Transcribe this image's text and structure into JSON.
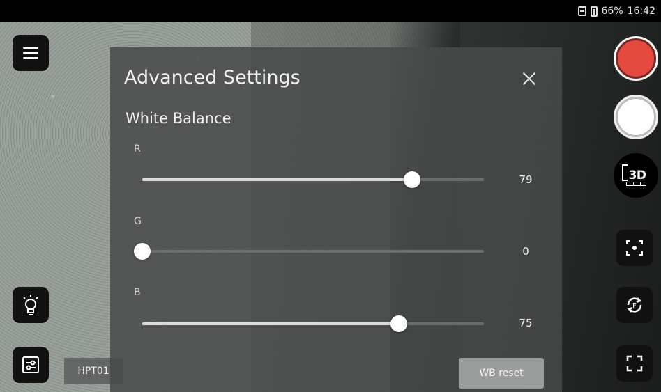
{
  "status_bar": {
    "battery": "66%",
    "time": "16:42",
    "icons": [
      "sim-card-icon",
      "battery-icon"
    ]
  },
  "panel": {
    "title": "Advanced Settings",
    "section_title": "White Balance",
    "sliders": [
      {
        "label": "R",
        "value": "79",
        "min": 0,
        "max": 100,
        "level": 79
      },
      {
        "label": "G",
        "value": "0",
        "min": 0,
        "max": 100,
        "level": 0
      },
      {
        "label": "B",
        "value": "75",
        "min": 0,
        "max": 100,
        "level": 75
      }
    ],
    "reset_label": "WB reset"
  },
  "left_toolbar": {
    "device_label": "HPT01",
    "icons": [
      "menu-icon",
      "lightbulb-icon",
      "settings-sliders-icon"
    ]
  },
  "right_toolbar": {
    "three_d_label": "3D",
    "icons": [
      "record-icon",
      "capture-icon",
      "3d-measure-icon",
      "focus-target-icon",
      "rotate-icon",
      "fullscreen-icon"
    ],
    "record_color": "#e44a3e"
  }
}
